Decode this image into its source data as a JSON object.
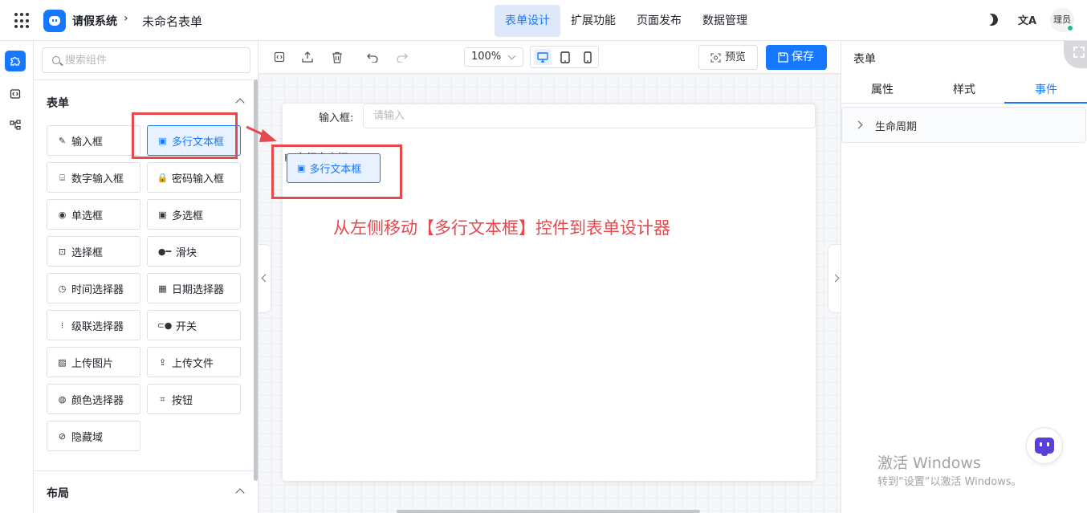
{
  "header": {
    "app_name": "请假系统",
    "separator": "›",
    "form_name": "未命名表单",
    "nav": [
      {
        "label": "表单设计",
        "active": true
      },
      {
        "label": "扩展功能",
        "active": false
      },
      {
        "label": "页面发布",
        "active": false
      },
      {
        "label": "数据管理",
        "active": false
      }
    ],
    "translate_glyph": "文A",
    "user_name": "理员"
  },
  "component_panel": {
    "search_placeholder": "搜索组件",
    "section_form": "表单",
    "section_layout": "布局",
    "components": [
      {
        "label": "输入框",
        "icon": "pencil-icon",
        "glyph": "✎"
      },
      {
        "label": "多行文本框",
        "icon": "textarea-icon",
        "glyph": "▣",
        "active": true
      },
      {
        "label": "数字输入框",
        "icon": "number-icon",
        "glyph": "⌸"
      },
      {
        "label": "密码输入框",
        "icon": "lock-icon",
        "glyph": "🔒"
      },
      {
        "label": "单选框",
        "icon": "radio-icon",
        "glyph": "◉"
      },
      {
        "label": "多选框",
        "icon": "checkbox-icon",
        "glyph": "▣"
      },
      {
        "label": "选择框",
        "icon": "select-icon",
        "glyph": "⊡"
      },
      {
        "label": "滑块",
        "icon": "slider-icon",
        "glyph": "●━"
      },
      {
        "label": "时间选择器",
        "icon": "clock-icon",
        "glyph": "◷"
      },
      {
        "label": "日期选择器",
        "icon": "calendar-icon",
        "glyph": "▦"
      },
      {
        "label": "级联选择器",
        "icon": "cascade-icon",
        "glyph": "⁝"
      },
      {
        "label": "开关",
        "icon": "switch-icon",
        "glyph": "⊂●"
      },
      {
        "label": "上传图片",
        "icon": "image-icon",
        "glyph": "▨"
      },
      {
        "label": "上传文件",
        "icon": "upload-icon",
        "glyph": "⇪"
      },
      {
        "label": "颜色选择器",
        "icon": "palette-icon",
        "glyph": "◍"
      },
      {
        "label": "按钮",
        "icon": "button-icon",
        "glyph": "⌗"
      },
      {
        "label": "隐藏域",
        "icon": "eye-off-icon",
        "glyph": "⊘"
      }
    ]
  },
  "toolbar": {
    "zoom": "100%",
    "preview_label": "预览",
    "save_label": "保存"
  },
  "canvas": {
    "input_label": "输入框:",
    "input_placeholder": "请输入",
    "drag_ghost_label": "多行文本框",
    "drag_ghost_button": "多行文本框"
  },
  "annotation": {
    "text": "从左侧移动【多行文本框】控件到表单设计器",
    "color": "#e5484d"
  },
  "property_panel": {
    "title": "表单",
    "tabs": [
      {
        "label": "属性",
        "active": false
      },
      {
        "label": "样式",
        "active": false
      },
      {
        "label": "事件",
        "active": true
      }
    ],
    "collapse_label": "生命周期"
  },
  "watermark": {
    "title": "激活 Windows",
    "subtitle": "转到“设置”以激活 Windows。"
  },
  "colors": {
    "accent": "#1677ff",
    "annotation_red": "#e5484d",
    "online_dot": "#18c07b"
  }
}
